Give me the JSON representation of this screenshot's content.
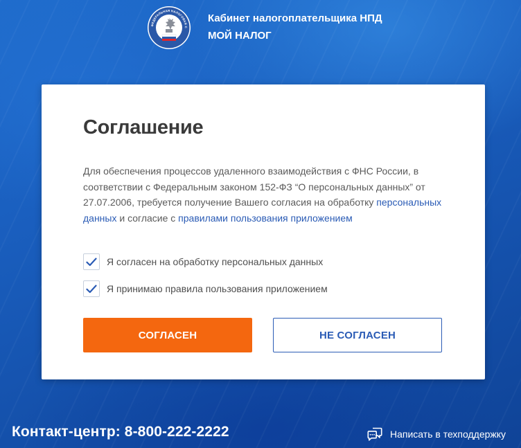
{
  "header": {
    "line1": "Кабинет налогоплательщика НПД",
    "line2": "МОЙ НАЛОГ",
    "logo_text": "ФЕДЕРАЛЬНАЯ НАЛОГОВАЯ СЛУЖБА"
  },
  "agreement": {
    "title": "Соглашение",
    "text_part1": "Для обеспечения процессов удаленного взаимодействия с ФНС России, в соответствии с Федеральным законом 152-ФЗ “О персональных данных” от 27.07.2006, требуется получение Вашего согласия на обработку",
    "link_personal_data": "персональных данных",
    "text_part2": "и согласие с",
    "link_rules": "правилами пользования приложением",
    "checkboxes": [
      {
        "label": "Я согласен на обработку персональных данных",
        "checked": true
      },
      {
        "label": "Я принимаю правила пользования приложением",
        "checked": true
      }
    ],
    "agree_label": "СОГЛАСЕН",
    "disagree_label": "НЕ СОГЛАСЕН"
  },
  "footer": {
    "contact": "Контакт-центр: 8-800-222-2222",
    "support_label": "Написать в техподдержку"
  },
  "colors": {
    "accent": "#f4670f",
    "link": "#2a5bb5",
    "background": "#1a5fbf"
  }
}
